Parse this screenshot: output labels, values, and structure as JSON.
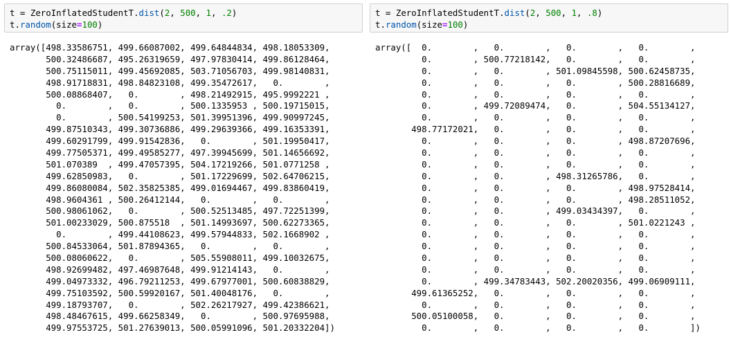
{
  "cells": [
    {
      "code": {
        "line1": {
          "var": "t",
          "eq": " = ",
          "cls": "ZeroInflatedStudentT",
          "dot": ".",
          "method": "dist",
          "open": "(",
          "a1": "2",
          "c1": ", ",
          "a2": "500",
          "c2": ", ",
          "a3": "1",
          "c3": ", ",
          "a4": ".2",
          "close": ")"
        },
        "line2": {
          "var": "t",
          "dot": ".",
          "method": "random",
          "open": "(",
          "kw": "size",
          "eq": "=",
          "val": "100",
          "close": ")"
        }
      },
      "output": [
        "array([498.33586751, 499.66087002, 499.64844834, 498.18053309,",
        "       500.32486687, 495.26319659, 497.97830414, 499.86128464,",
        "       500.75115011, 499.45692085, 503.71056703, 499.98140831,",
        "       498.91718831, 498.84823108, 499.35472617,   0.        ,",
        "       500.08868407,   0.        , 498.21492915, 495.9992221 ,",
        "         0.        ,   0.        , 500.1335953 , 500.19715015,",
        "         0.        , 500.54199253, 501.39951396, 499.90997245,",
        "       499.87510343, 499.30736886, 499.29639366, 499.16353391,",
        "       499.60291799, 499.91542836,   0.        , 501.19950417,",
        "       499.77505371, 499.49585277, 497.39945699, 501.14656692,",
        "       501.070389  , 499.47057395, 504.17219266, 501.0771258 ,",
        "       499.62850983,   0.        , 501.17229699, 502.64706215,",
        "       499.86080084, 502.35825385, 499.01694467, 499.83860419,",
        "       498.9604361 , 500.26412144,   0.        ,   0.        ,",
        "       500.98061062,   0.        , 500.52513485, 497.72251399,",
        "       501.00233029, 500.875518  , 501.14993697, 500.62273365,",
        "         0.        , 499.44108623, 499.57944833, 502.1668902 ,",
        "       500.84533064, 501.87894365,   0.        ,   0.        ,",
        "       500.08060622,   0.        , 505.55908011, 499.10032675,",
        "       498.92699482, 497.46987648, 499.91214143,   0.        ,",
        "       499.04973332, 496.79211253, 499.67977001, 500.60838829,",
        "       499.75103592, 500.59920167, 501.40048176,   0.        ,",
        "       499.18793707,   0.        , 502.26217927, 499.42386621,",
        "       498.48467615, 499.66258349,   0.        , 500.97695988,",
        "       499.97553725, 501.27639013, 500.05991096, 501.20332204])"
      ]
    },
    {
      "code": {
        "line1": {
          "var": "t",
          "eq": " = ",
          "cls": "ZeroInflatedStudentT",
          "dot": ".",
          "method": "dist",
          "open": "(",
          "a1": "2",
          "c1": ", ",
          "a2": "500",
          "c2": ", ",
          "a3": "1",
          "c3": ", ",
          "a4": ".8",
          "close": ")"
        },
        "line2": {
          "var": "t",
          "dot": ".",
          "method": "random",
          "open": "(",
          "kw": "size",
          "eq": "=",
          "val": "100",
          "close": ")"
        }
      },
      "output": [
        "array([  0.        ,   0.        ,   0.        ,   0.        ,",
        "         0.        , 500.77218142,   0.        ,   0.        ,",
        "         0.        ,   0.        , 501.09845598, 500.62458735,",
        "         0.        ,   0.        ,   0.        , 500.28816689,",
        "         0.        ,   0.        ,   0.        ,   0.        ,",
        "         0.        , 499.72089474,   0.        , 504.55134127,",
        "         0.        ,   0.        ,   0.        ,   0.        ,",
        "       498.77172021,   0.        ,   0.        ,   0.        ,",
        "         0.        ,   0.        ,   0.        , 498.87207696,",
        "         0.        ,   0.        ,   0.        ,   0.        ,",
        "         0.        ,   0.        ,   0.        ,   0.        ,",
        "         0.        ,   0.        , 498.31265786,   0.        ,",
        "         0.        ,   0.        ,   0.        , 498.97528414,",
        "         0.        ,   0.        ,   0.        , 498.28511052,",
        "         0.        ,   0.        , 499.03434397,   0.        ,",
        "         0.        ,   0.        ,   0.        , 501.0221243 ,",
        "         0.        ,   0.        ,   0.        ,   0.        ,",
        "         0.        ,   0.        ,   0.        ,   0.        ,",
        "         0.        ,   0.        ,   0.        ,   0.        ,",
        "         0.        ,   0.        ,   0.        ,   0.        ,",
        "         0.        , 499.34783443, 502.20020356, 499.06909111,",
        "       499.61365252,   0.        ,   0.        ,   0.        ,",
        "         0.        ,   0.        ,   0.        ,   0.        ,",
        "       500.05100058,   0.        ,   0.        ,   0.        ,",
        "         0.        ,   0.        ,   0.        ,   0.        ])"
      ]
    }
  ]
}
